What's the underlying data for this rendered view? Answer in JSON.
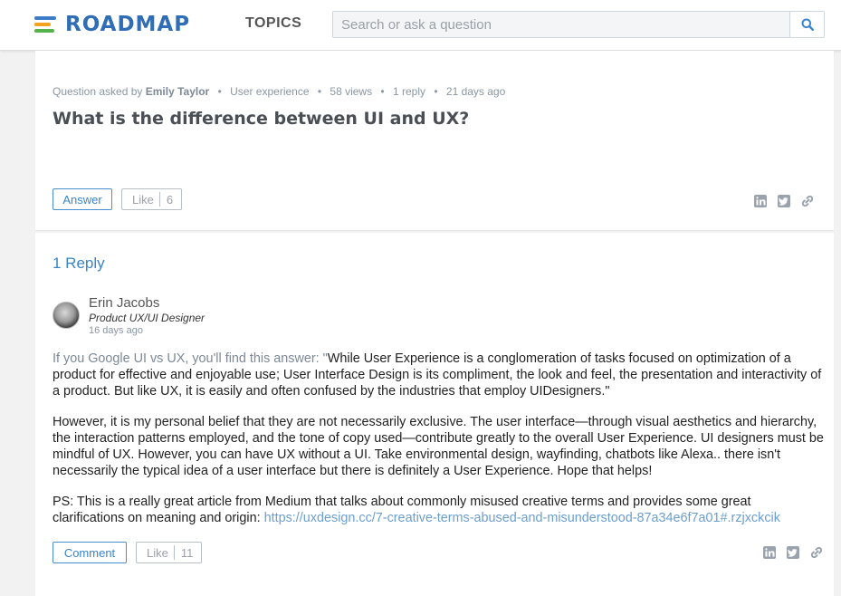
{
  "header": {
    "brand": "ROADMAP",
    "topics_label": "TOPICS",
    "search_placeholder": "Search or ask a question"
  },
  "question": {
    "meta_prefix": "Question asked by",
    "author": "Emily Taylor",
    "category": "User experience",
    "views": "58 views",
    "replies": "1 reply",
    "age": "21 days ago",
    "title": "What is the difference between UI and UX?",
    "answer_label": "Answer",
    "like_label": "Like",
    "like_count": "6"
  },
  "replies": {
    "count_label": "1 Reply",
    "items": [
      {
        "author": "Erin Jacobs",
        "role": "Product UX/UI Designer",
        "age": "16 days ago",
        "p1_lead": "If you Google UI vs UX, you'll find this answer: \"",
        "p1_quote": "While User Experience is a conglomeration of tasks focused on optimization of a product for effective and enjoyable use; User Interface Design is its compliment, the look and feel, the presentation and interactivity of a product. But like UX, it is easily and often confused by the industries that employ UIDesigners.\"",
        "p2": "However, it is my personal belief that they are not necessarily exclusive. The user interface—through visual aesthetics and hierarchy, the interaction patterns employed, and the tone of copy used—contribute greatly to the overall User Experience. UI designers must be mindful of UX. However, you can have UX without a UI. Take environmental design, wayfinding, chatbots like Alexa.. there isn't necessarily the typical idea of a user interface but there is definitely a User Experience. Hope that helps!",
        "p3_text": "PS: This is a really great article from Medium that talks about commonly misused creative terms and provides some great clarifications on meaning and origin: ",
        "p3_link": "https://uxdesign.cc/7-creative-terms-abused-and-misunderstood-87a34e6f7a01#.rzjxckcik",
        "comment_label": "Comment",
        "like_label": "Like",
        "like_count": "11"
      }
    ]
  },
  "icons": {
    "search": "search-icon",
    "linkedin": "linkedin-icon",
    "twitter": "twitter-icon",
    "link": "link-icon"
  },
  "colors": {
    "brand_blue": "#2f6db5",
    "accent_blue": "#3a84c9",
    "meta_grey": "#8a96a3",
    "logo_orange": "#f2a21d",
    "logo_green": "#56b24a"
  }
}
